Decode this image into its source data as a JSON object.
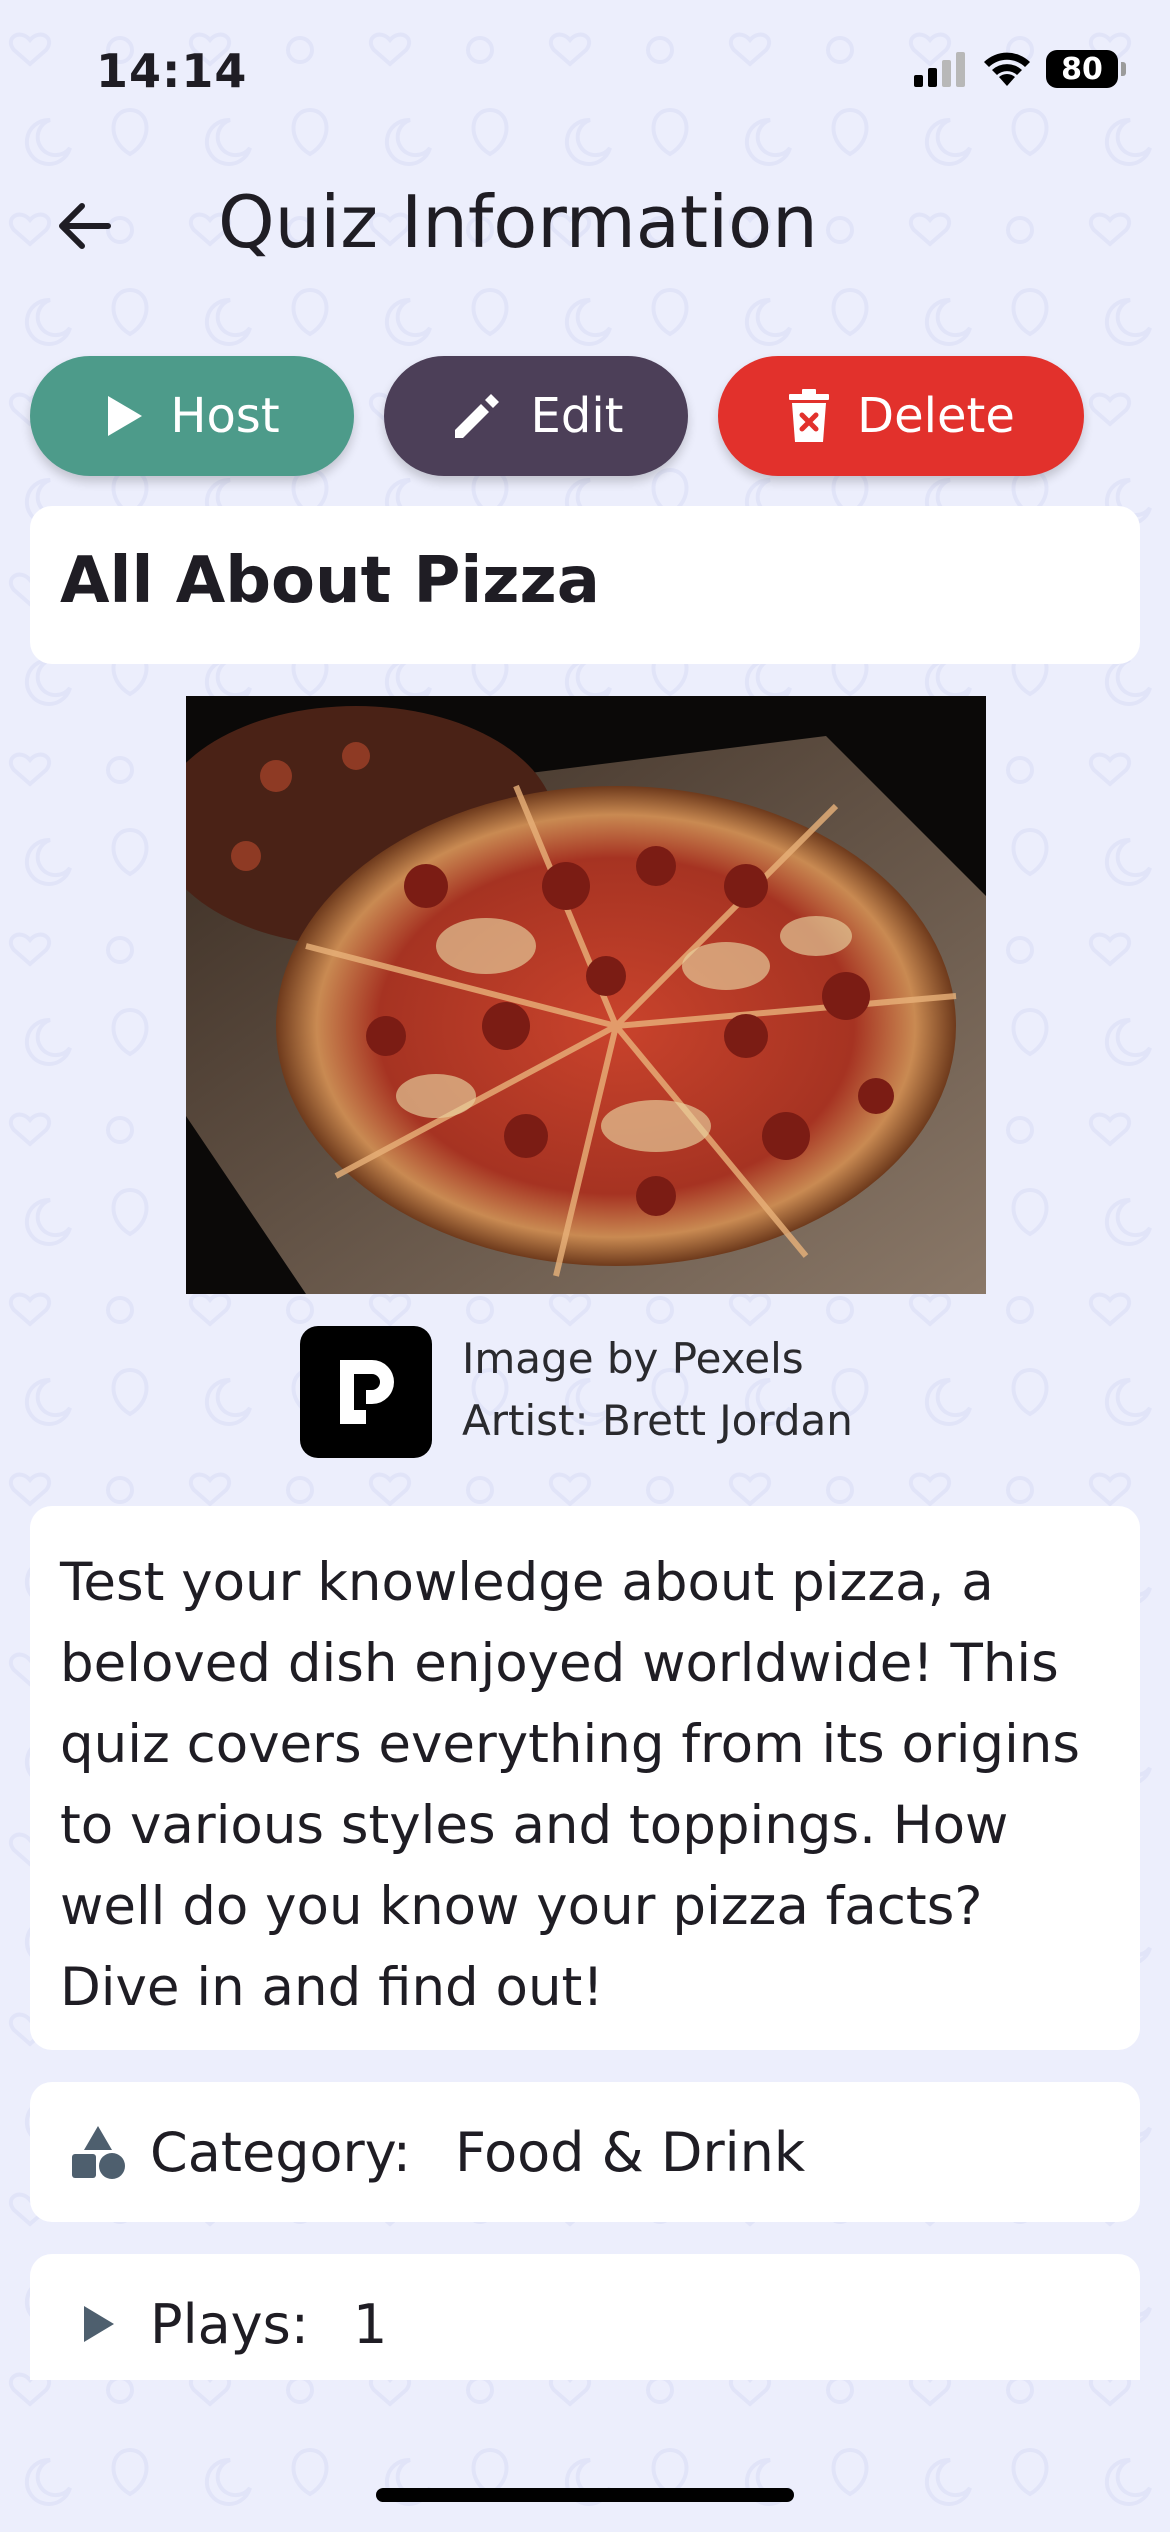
{
  "status_bar": {
    "time": "14:14",
    "battery": "80",
    "icons": [
      "signal-icon",
      "wifi-icon",
      "battery-icon"
    ]
  },
  "header": {
    "title": "Quiz Information",
    "back_icon": "arrow-left-icon"
  },
  "actions": {
    "host_label": "Host",
    "edit_label": "Edit",
    "delete_label": "Delete",
    "colors": {
      "host": "#4d9b8a",
      "edit": "#4c3f58",
      "delete": "#e2312c"
    }
  },
  "quiz": {
    "title": "All About Pizza",
    "image_alt": "Pepperoni pizza on a wooden board",
    "credit": {
      "source": "Image by Pexels",
      "artist": "Artist: Brett Jordan"
    },
    "description": "Test your knowledge about pizza, a beloved dish enjoyed worldwide! This quiz covers everything from its origins to various styles and toppings. How well do you know your pizza facts? Dive in and find out!",
    "category_label": "Category:",
    "category_value": "Food & Drink",
    "plays_label": "Plays:",
    "plays_value": "1"
  },
  "theme": {
    "background": "#eceefc",
    "card": "#ffffff",
    "icon": "#4e5f6e"
  }
}
